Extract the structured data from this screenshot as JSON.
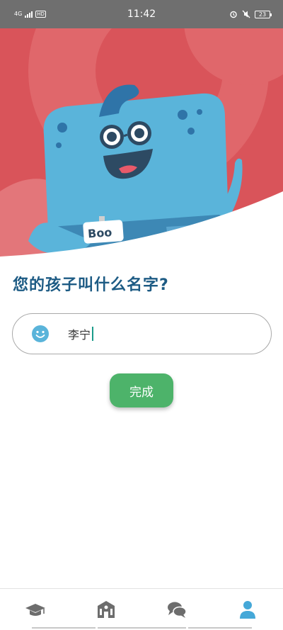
{
  "status_bar": {
    "network": "4G",
    "hd": "HD",
    "time": "11:42",
    "battery": "23"
  },
  "hero": {
    "mascot_badge": "Boo"
  },
  "question": "您的孩子叫什么名字?",
  "name_field": {
    "value": "李宁"
  },
  "done_button": "完成",
  "nav": {
    "items": [
      {
        "icon": "graduation-cap-icon",
        "active": false
      },
      {
        "icon": "school-building-icon",
        "active": false
      },
      {
        "icon": "chat-bubbles-icon",
        "active": false
      },
      {
        "icon": "user-icon",
        "active": true
      }
    ]
  },
  "colors": {
    "hero_bg": "#d9545a",
    "mascot": "#5ab4da",
    "accent_text": "#1d5b84",
    "done_button": "#4db36a",
    "nav_inactive": "#6d6d6d",
    "nav_active": "#45a8d8"
  }
}
